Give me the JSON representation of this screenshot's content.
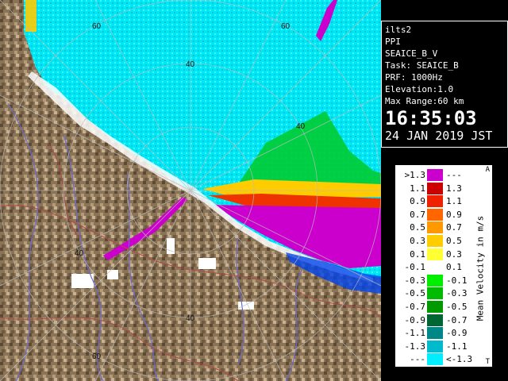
{
  "info_panel": {
    "site": "ilts2",
    "product": "PPI",
    "product_name": "SEAICE_B_V",
    "task": "Task: SEAICE_B",
    "prf": "PRF: 1000Hz",
    "elevation": "Elevation:1.0",
    "max_range": "Max Range:60 km",
    "time": "16:35:03",
    "date": "24 JAN 2019 JST"
  },
  "range_labels": [
    "60",
    "60",
    "40",
    "40",
    "40",
    "40",
    "60"
  ],
  "legend": {
    "title": "Mean Velocity in m/s",
    "top_mark": "A",
    "bottom_mark": "T",
    "rows": [
      {
        "lo": ">1.3",
        "hi": "---",
        "color": "#cc00cc"
      },
      {
        "lo": "1.1",
        "hi": "1.3",
        "color": "#cc0000"
      },
      {
        "lo": "0.9",
        "hi": "1.1",
        "color": "#ee2200"
      },
      {
        "lo": "0.7",
        "hi": "0.9",
        "color": "#ff6600"
      },
      {
        "lo": "0.5",
        "hi": "0.7",
        "color": "#ff9900"
      },
      {
        "lo": "0.3",
        "hi": "0.5",
        "color": "#ffcc00"
      },
      {
        "lo": "0.1",
        "hi": "0.3",
        "color": "#ffff33"
      },
      {
        "lo": "-0.1",
        "hi": "0.1",
        "color": "#ffffff"
      },
      {
        "lo": "-0.3",
        "hi": "-0.1",
        "color": "#00ee00"
      },
      {
        "lo": "-0.5",
        "hi": "-0.3",
        "color": "#00bb00"
      },
      {
        "lo": "-0.7",
        "hi": "-0.5",
        "color": "#009900"
      },
      {
        "lo": "-0.9",
        "hi": "-0.7",
        "color": "#006633"
      },
      {
        "lo": "-1.1",
        "hi": "-0.9",
        "color": "#008888"
      },
      {
        "lo": "-1.3",
        "hi": "-1.1",
        "color": "#00bbcc"
      },
      {
        "lo": "---",
        "hi": "<-1.3",
        "color": "#00eeff"
      }
    ]
  },
  "colors": {
    "land": "#8b7355",
    "sea_ice_echo": "#00eeff",
    "rivers": "#6666cc",
    "borders": "#aa4444"
  }
}
